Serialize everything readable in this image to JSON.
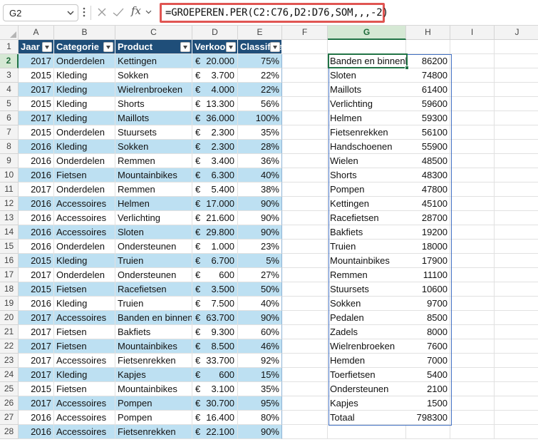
{
  "formula_bar": {
    "name_box": "G2",
    "formula": "=GROEPEREN.PER(C2:C76,D2:D76,SOM,,,-2)",
    "fx_label": "fx",
    "icons": [
      "chevron-down-icon",
      "more-options-icon",
      "cancel-icon",
      "enter-icon",
      "function-icon"
    ]
  },
  "columns": [
    "A",
    "B",
    "C",
    "D",
    "E",
    "F",
    "G",
    "H",
    "I",
    "J"
  ],
  "rows": [
    "1",
    "2",
    "3",
    "4",
    "5",
    "6",
    "7",
    "8",
    "9",
    "10",
    "11",
    "12",
    "13",
    "14",
    "15",
    "16",
    "17",
    "18",
    "19",
    "20",
    "21",
    "22",
    "23",
    "24",
    "25",
    "26",
    "27",
    "28"
  ],
  "table": {
    "headers": [
      "Jaar",
      "Categorie",
      "Product",
      "Verkoop",
      "Classificatie"
    ],
    "rows": [
      [
        "2017",
        "Onderdelen",
        "Kettingen",
        "20.000",
        "75%"
      ],
      [
        "2015",
        "Kleding",
        "Sokken",
        "3.700",
        "22%"
      ],
      [
        "2017",
        "Kleding",
        "Wielrenbroeken",
        "4.000",
        "22%"
      ],
      [
        "2015",
        "Kleding",
        "Shorts",
        "13.300",
        "56%"
      ],
      [
        "2017",
        "Kleding",
        "Maillots",
        "36.000",
        "100%"
      ],
      [
        "2015",
        "Onderdelen",
        "Stuursets",
        "2.300",
        "35%"
      ],
      [
        "2016",
        "Kleding",
        "Sokken",
        "2.300",
        "28%"
      ],
      [
        "2016",
        "Onderdelen",
        "Remmen",
        "3.400",
        "36%"
      ],
      [
        "2016",
        "Fietsen",
        "Mountainbikes",
        "6.300",
        "40%"
      ],
      [
        "2017",
        "Onderdelen",
        "Remmen",
        "5.400",
        "38%"
      ],
      [
        "2016",
        "Accessoires",
        "Helmen",
        "17.000",
        "90%"
      ],
      [
        "2016",
        "Accessoires",
        "Verlichting",
        "21.600",
        "90%"
      ],
      [
        "2016",
        "Accessoires",
        "Sloten",
        "29.800",
        "90%"
      ],
      [
        "2016",
        "Onderdelen",
        "Ondersteunen",
        "1.000",
        "23%"
      ],
      [
        "2015",
        "Kleding",
        "Truien",
        "6.700",
        "5%"
      ],
      [
        "2017",
        "Onderdelen",
        "Ondersteunen",
        "600",
        "27%"
      ],
      [
        "2015",
        "Fietsen",
        "Racefietsen",
        "3.500",
        "50%"
      ],
      [
        "2016",
        "Kleding",
        "Truien",
        "7.500",
        "40%"
      ],
      [
        "2017",
        "Accessoires",
        "Banden en binnenbanden",
        "63.700",
        "90%"
      ],
      [
        "2017",
        "Fietsen",
        "Bakfiets",
        "9.300",
        "60%"
      ],
      [
        "2017",
        "Fietsen",
        "Mountainbikes",
        "8.500",
        "46%"
      ],
      [
        "2017",
        "Accessoires",
        "Fietsenrekken",
        "33.700",
        "92%"
      ],
      [
        "2017",
        "Kleding",
        "Kapjes",
        "600",
        "15%"
      ],
      [
        "2015",
        "Fietsen",
        "Mountainbikes",
        "3.100",
        "35%"
      ],
      [
        "2017",
        "Accessoires",
        "Pompen",
        "30.700",
        "95%"
      ],
      [
        "2016",
        "Accessoires",
        "Pompen",
        "16.400",
        "80%"
      ],
      [
        "2016",
        "Accessoires",
        "Fietsenrekken",
        "22.100",
        "90%"
      ]
    ]
  },
  "currency_symbol": "€",
  "grouped": {
    "rows": [
      [
        "Banden en binnenbanden",
        "86200"
      ],
      [
        "Sloten",
        "74800"
      ],
      [
        "Maillots",
        "61400"
      ],
      [
        "Verlichting",
        "59600"
      ],
      [
        "Helmen",
        "59300"
      ],
      [
        "Fietsenrekken",
        "56100"
      ],
      [
        "Handschoenen",
        "55900"
      ],
      [
        "Wielen",
        "48500"
      ],
      [
        "Shorts",
        "48300"
      ],
      [
        "Pompen",
        "47800"
      ],
      [
        "Kettingen",
        "45100"
      ],
      [
        "Racefietsen",
        "28700"
      ],
      [
        "Bakfiets",
        "19200"
      ],
      [
        "Truien",
        "18000"
      ],
      [
        "Mountainbikes",
        "17900"
      ],
      [
        "Remmen",
        "11100"
      ],
      [
        "Stuursets",
        "10600"
      ],
      [
        "Sokken",
        "9700"
      ],
      [
        "Pedalen",
        "8500"
      ],
      [
        "Zadels",
        "8000"
      ],
      [
        "Wielrenbroeken",
        "7600"
      ],
      [
        "Hemden",
        "7000"
      ],
      [
        "Toerfietsen",
        "5400"
      ],
      [
        "Ondersteunen",
        "2100"
      ],
      [
        "Kapjes",
        "1500"
      ],
      [
        "Totaal",
        "798300"
      ]
    ]
  },
  "colors": {
    "table_header": "#1f4e79",
    "band": "#bde0f2",
    "selection": "#217346",
    "formula_highlight": "#e05552",
    "spill_border": "#4472c4"
  }
}
